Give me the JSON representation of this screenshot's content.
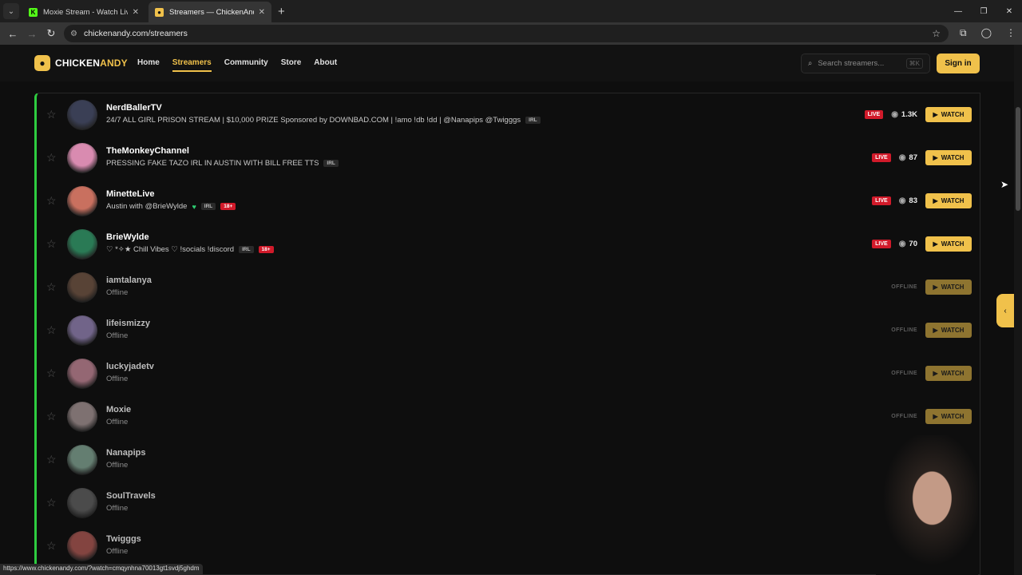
{
  "browser": {
    "tabs": [
      {
        "title": "Moxie Stream - Watch Live on Ki",
        "favicon": "K",
        "favicon_color": "#53fc18",
        "active": false
      },
      {
        "title": "Streamers — ChickenAndy",
        "favicon": "●",
        "favicon_color": "#f0c14b",
        "active": true
      }
    ],
    "url": "chickenandy.com/streamers",
    "status_url": "https://www.chickenandy.com/?watch=cmqynhna70013gt1svdj5ghdm"
  },
  "site": {
    "brand_a": "CHICKEN",
    "brand_b": "ANDY",
    "nav": [
      "Home",
      "Streamers",
      "Community",
      "Store",
      "About"
    ],
    "nav_active": "Streamers",
    "search_placeholder": "Search streamers...",
    "search_shortcut": "⌘K",
    "signin_label": "Sign in",
    "accent": "#f0c14b",
    "live_color": "#d11a2a",
    "online_border_color": "#2ecc40"
  },
  "streamers": [
    {
      "name": "NerdBallerTV",
      "subtitle": "24/7 ALL GIRL PRISON STREAM | $10,000 PRIZE Sponsored by DOWNBAD.COM | !amo !db !dd | @Nanapips @Twigggs",
      "tags": [
        "IRL"
      ],
      "adult": false,
      "heart": false,
      "live": true,
      "viewers": "1.3K",
      "avatar_color": "#3a3f55"
    },
    {
      "name": "TheMonkeyChannel",
      "subtitle": "PRESSING FAKE TAZO IRL IN AUSTIN WITH BILL FREE TTS",
      "tags": [
        "IRL"
      ],
      "adult": false,
      "heart": false,
      "live": true,
      "viewers": "87",
      "avatar_color": "#d98bb0"
    },
    {
      "name": "MinetteLive",
      "subtitle": "Austin with @BrieWylde",
      "tags": [
        "IRL"
      ],
      "adult": true,
      "heart": true,
      "live": true,
      "viewers": "83",
      "avatar_color": "#c9705f"
    },
    {
      "name": "BrieWylde",
      "subtitle": "♡ *✧★ Chill Vibes ♡ !socials !discord",
      "tags": [
        "IRL"
      ],
      "adult": true,
      "heart": false,
      "live": true,
      "viewers": "70",
      "avatar_color": "#2a7a55"
    },
    {
      "name": "iamtalanya",
      "subtitle": "Offline",
      "tags": [],
      "adult": false,
      "heart": false,
      "live": false,
      "viewers": "",
      "avatar_color": "#6b5040"
    },
    {
      "name": "lifeismizzy",
      "subtitle": "Offline",
      "tags": [],
      "adult": false,
      "heart": false,
      "live": false,
      "viewers": "",
      "avatar_color": "#8a7aa8"
    },
    {
      "name": "luckyjadetv",
      "subtitle": "Offline",
      "tags": [],
      "adult": false,
      "heart": false,
      "live": false,
      "viewers": "",
      "avatar_color": "#b57d8c"
    },
    {
      "name": "Moxie",
      "subtitle": "Offline",
      "tags": [],
      "adult": false,
      "heart": false,
      "live": false,
      "viewers": "",
      "avatar_color": "#9a8a8a"
    },
    {
      "name": "Nanapips",
      "subtitle": "Offline",
      "tags": [],
      "adult": false,
      "heart": false,
      "live": false,
      "viewers": "",
      "avatar_color": "#7a9a8a"
    },
    {
      "name": "SoulTravels",
      "subtitle": "Offline",
      "tags": [],
      "adult": false,
      "heart": false,
      "live": false,
      "viewers": "",
      "avatar_color": "#5a5a5a"
    },
    {
      "name": "Twigggs",
      "subtitle": "Offline",
      "tags": [],
      "adult": false,
      "heart": false,
      "live": false,
      "viewers": "",
      "avatar_color": "#a0524d"
    }
  ],
  "labels": {
    "live": "LIVE",
    "offline": "OFFLINE",
    "watch": "WATCH",
    "adult_tag": "18+"
  }
}
